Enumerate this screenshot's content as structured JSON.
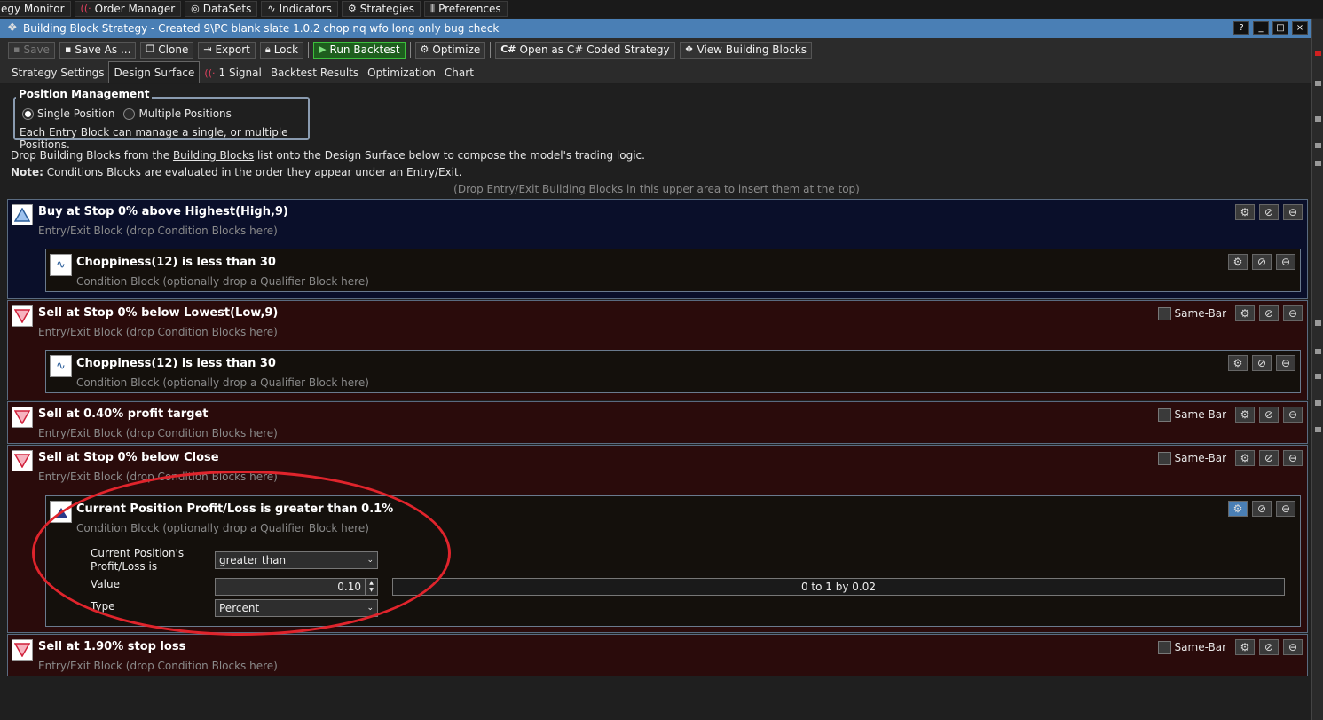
{
  "topbar": {
    "items": [
      {
        "label": "egy Monitor",
        "icon": ""
      },
      {
        "label": "Order Manager",
        "icon": "signal-icon"
      },
      {
        "label": "DataSets",
        "icon": "globe-icon"
      },
      {
        "label": "Indicators",
        "icon": "wave-icon"
      },
      {
        "label": "Strategies",
        "icon": "strategy-icon"
      },
      {
        "label": "Preferences",
        "icon": "sliders-icon"
      }
    ]
  },
  "window": {
    "title": "Building Block Strategy - Created 9\\PC blank slate 1.0.2 chop nq wfo long only bug check",
    "controls": [
      "?",
      "_",
      "□",
      "×"
    ]
  },
  "toolbar": {
    "save": "Save",
    "save_as": "Save As ...",
    "clone": "Clone",
    "export": "Export",
    "lock": "Lock",
    "run_backtest": "Run Backtest",
    "optimize": "Optimize",
    "open_csharp": "Open as C# Coded Strategy",
    "view_blocks": "View Building Blocks"
  },
  "tabs": [
    {
      "label": "Strategy Settings",
      "active": false
    },
    {
      "label": "Design Surface",
      "active": true
    },
    {
      "label": "1 Signal",
      "active": false
    },
    {
      "label": "Backtest Results",
      "active": false
    },
    {
      "label": "Optimization",
      "active": false
    },
    {
      "label": "Chart",
      "active": false
    }
  ],
  "position_management": {
    "legend": "Position Management",
    "single": "Single Position",
    "multiple": "Multiple Positions",
    "selected": "single",
    "description": "Each Entry Block can manage a single, or multiple Positions."
  },
  "info": {
    "line1_prefix": "Drop Building Blocks from the ",
    "line1_link": "Building Blocks",
    "line1_suffix": " list onto the Design Surface below to compose the model's trading logic.",
    "note_label": "Note:",
    "note_text": " Conditions Blocks are evaluated in the order they appear under an Entry/Exit.",
    "drop_hint": "(Drop Entry/Exit Building Blocks in this upper area to insert them at the top)"
  },
  "blocks": {
    "b1": {
      "title": "Buy at Stop 0% above Highest(High,9)",
      "sub": "Entry/Exit Block (drop Condition Blocks here)"
    },
    "b1c1": {
      "title": "Choppiness(12) is less than 30",
      "sub": "Condition Block (optionally drop a Qualifier Block here)"
    },
    "b2": {
      "title": "Sell at Stop 0% below Lowest(Low,9)",
      "sub": "Entry/Exit Block (drop Condition Blocks here)",
      "samebar": "Same-Bar"
    },
    "b2c1": {
      "title": "Choppiness(12) is less than 30",
      "sub": "Condition Block (optionally drop a Qualifier Block here)"
    },
    "b3": {
      "title": "Sell at 0.40% profit target",
      "sub": "Entry/Exit Block (drop Condition Blocks here)",
      "samebar": "Same-Bar"
    },
    "b4": {
      "title": "Sell at Stop 0% below Close",
      "sub": "Entry/Exit Block (drop Condition Blocks here)",
      "samebar": "Same-Bar"
    },
    "b4c1": {
      "title": "Current Position Profit/Loss is greater than 0.1%",
      "sub": "Condition Block (optionally drop a Qualifier Block here)",
      "label_pl_1": "Current Position's",
      "label_pl_2": "Profit/Loss is",
      "comparison": "greater than",
      "label_value": "Value",
      "value": "0.10",
      "range": "0 to 1 by 0.02",
      "label_type": "Type",
      "type": "Percent"
    },
    "b5": {
      "title": "Sell at 1.90% stop loss",
      "sub": "Entry/Exit Block (drop Condition Blocks here)",
      "samebar": "Same-Bar"
    }
  },
  "colors": {
    "accent": "#4a7fb5",
    "buy_block_bg": "#0a0f2a",
    "sell_block_bg": "#2a0b0b",
    "run_button": "#3cbf3c",
    "annotation": "#e0242c"
  }
}
